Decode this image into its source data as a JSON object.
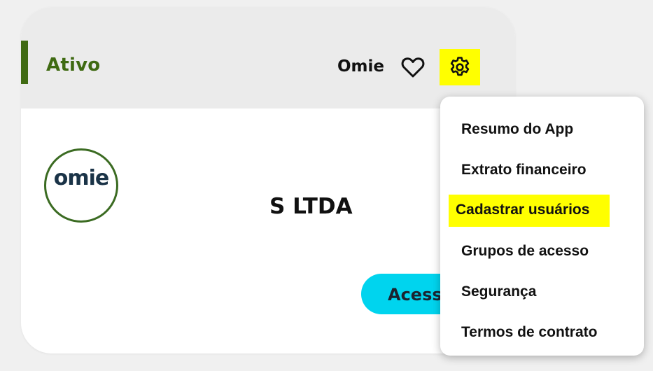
{
  "card": {
    "status": "Ativo",
    "vendor": "Omie",
    "logo_text": "omie",
    "company_name": "S LTDA",
    "access_button": "Acess",
    "icons": {
      "favorite": "heart-icon",
      "settings": "gear-icon"
    }
  },
  "menu": {
    "items": [
      {
        "label": "Resumo do App"
      },
      {
        "label": "Extrato financeiro"
      },
      {
        "label": "Cadastrar usuários",
        "highlighted": true
      },
      {
        "label": "Grupos de acesso"
      },
      {
        "label": "Segurança"
      },
      {
        "label": "Termos de contrato"
      }
    ]
  },
  "colors": {
    "status_green": "#3f6a12",
    "highlight": "#ffff00",
    "access_button": "#00d4ee",
    "header_bg": "#ebebeb"
  }
}
